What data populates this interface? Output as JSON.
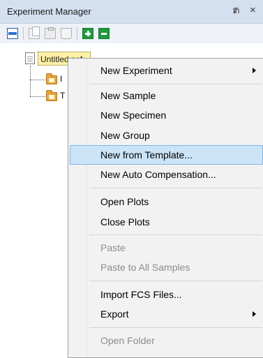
{
  "panel": {
    "title": "Experiment Manager",
    "pin_glyph": "ᵖ",
    "close_glyph": "×"
  },
  "toolbar": {
    "buttons": [
      {
        "icon": "collapse-bar-icon"
      },
      {
        "icon": "copy-icon"
      },
      {
        "icon": "paste-icon"
      },
      {
        "icon": "clipboard-icon"
      },
      {
        "icon": "add-icon"
      },
      {
        "icon": "remove-icon"
      }
    ]
  },
  "tree": {
    "root_label": "Untitled.pcf",
    "children": [
      {
        "label": "I"
      },
      {
        "label": "T"
      }
    ]
  },
  "context_menu": {
    "items": [
      {
        "label": "New Experiment",
        "submenu": true,
        "disabled": false
      },
      {
        "label": "New Sample",
        "submenu": false,
        "disabled": false
      },
      {
        "label": "New Specimen",
        "submenu": false,
        "disabled": false
      },
      {
        "label": "New Group",
        "submenu": false,
        "disabled": false
      },
      {
        "label": "New from Template...",
        "submenu": false,
        "disabled": false,
        "highlighted": true
      },
      {
        "label": "New Auto Compensation...",
        "submenu": false,
        "disabled": false
      },
      {
        "label": "Open Plots",
        "submenu": false,
        "disabled": false
      },
      {
        "label": "Close Plots",
        "submenu": false,
        "disabled": false
      },
      {
        "label": "Paste",
        "submenu": false,
        "disabled": true
      },
      {
        "label": "Paste to All Samples",
        "submenu": false,
        "disabled": true
      },
      {
        "label": "Import FCS Files...",
        "submenu": false,
        "disabled": false
      },
      {
        "label": "Export",
        "submenu": true,
        "disabled": false
      },
      {
        "label": "Open Folder",
        "submenu": false,
        "disabled": true
      }
    ]
  },
  "colors": {
    "titlebar_bg": "#d4dff0",
    "menu_highlight": "#cce4f7",
    "root_highlight": "#fff2a8",
    "icon_green": "#1f9a3c"
  }
}
